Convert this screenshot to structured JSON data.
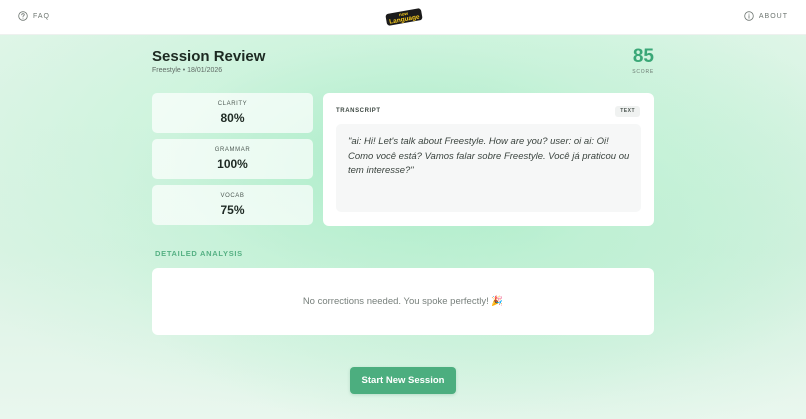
{
  "header": {
    "faq_label": "FAQ",
    "about_label": "ABOUT",
    "logo_top": "now",
    "logo_bottom": "Language"
  },
  "review": {
    "title": "Session Review",
    "subtitle": "Freestyle • 18/01/2026",
    "score": "85",
    "score_label": "SCORE"
  },
  "metrics": [
    {
      "label": "CLARITY",
      "value": "80%"
    },
    {
      "label": "GRAMMAR",
      "value": "100%"
    },
    {
      "label": "VOCAB",
      "value": "75%"
    }
  ],
  "transcript": {
    "label": "TRANSCRIPT",
    "badge": "TEXT",
    "text": "\"ai: Hi! Let's talk about Freestyle. How are you? user: oi ai: Oi! Como você está? Vamos falar sobre Freestyle. Você já praticou ou tem interesse?\""
  },
  "analysis": {
    "heading": "DETAILED ANALYSIS",
    "message": "No corrections needed. You spoke perfectly! 🎉"
  },
  "actions": {
    "start_label": "Start New Session"
  },
  "colors": {
    "accent": "#4cae7f",
    "score": "#3aa777",
    "section_heading": "#56b184",
    "logo_bg": "#1b1b1b",
    "logo_text": "#f4c81e"
  }
}
